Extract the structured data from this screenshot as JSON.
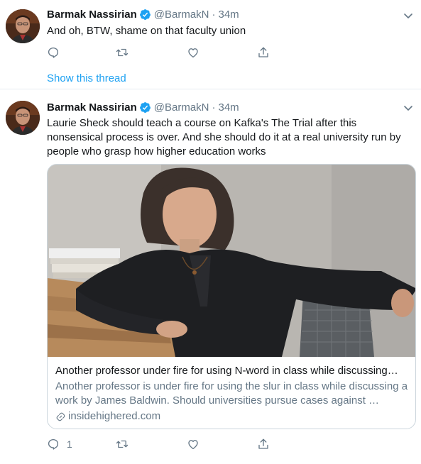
{
  "tweets": [
    {
      "author_name": "Barmak Nassirian",
      "handle": "@BarmakN",
      "separator": "·",
      "time": "34m",
      "text": "And oh, BTW, shame on that faculty union",
      "reply_count": "",
      "show_thread": "Show this thread"
    },
    {
      "author_name": "Barmak Nassirian",
      "handle": "@BarmakN",
      "separator": "·",
      "time": "34m",
      "text": "Laurie Sheck should teach a course on Kafka's The Trial after this nonsensical process is over. And she should do it at a real university run by people who grasp how higher education works",
      "reply_count": "1",
      "card": {
        "title": "Another professor under fire for using N-word in class while discussing…",
        "description": "Another professor is under fire for using the slur in class while discussing a work by James Baldwin. Should universities pursue cases against …",
        "domain": "insidehighered.com"
      }
    }
  ],
  "icons": {
    "verified": "verified-badge-icon",
    "caret": "chevron-down-icon",
    "reply": "reply-icon",
    "retweet": "retweet-icon",
    "like": "heart-icon",
    "share": "share-icon",
    "link": "link-icon"
  },
  "colors": {
    "accent": "#1da1f2",
    "secondary_text": "#657786",
    "divider": "#e6ecf0"
  }
}
